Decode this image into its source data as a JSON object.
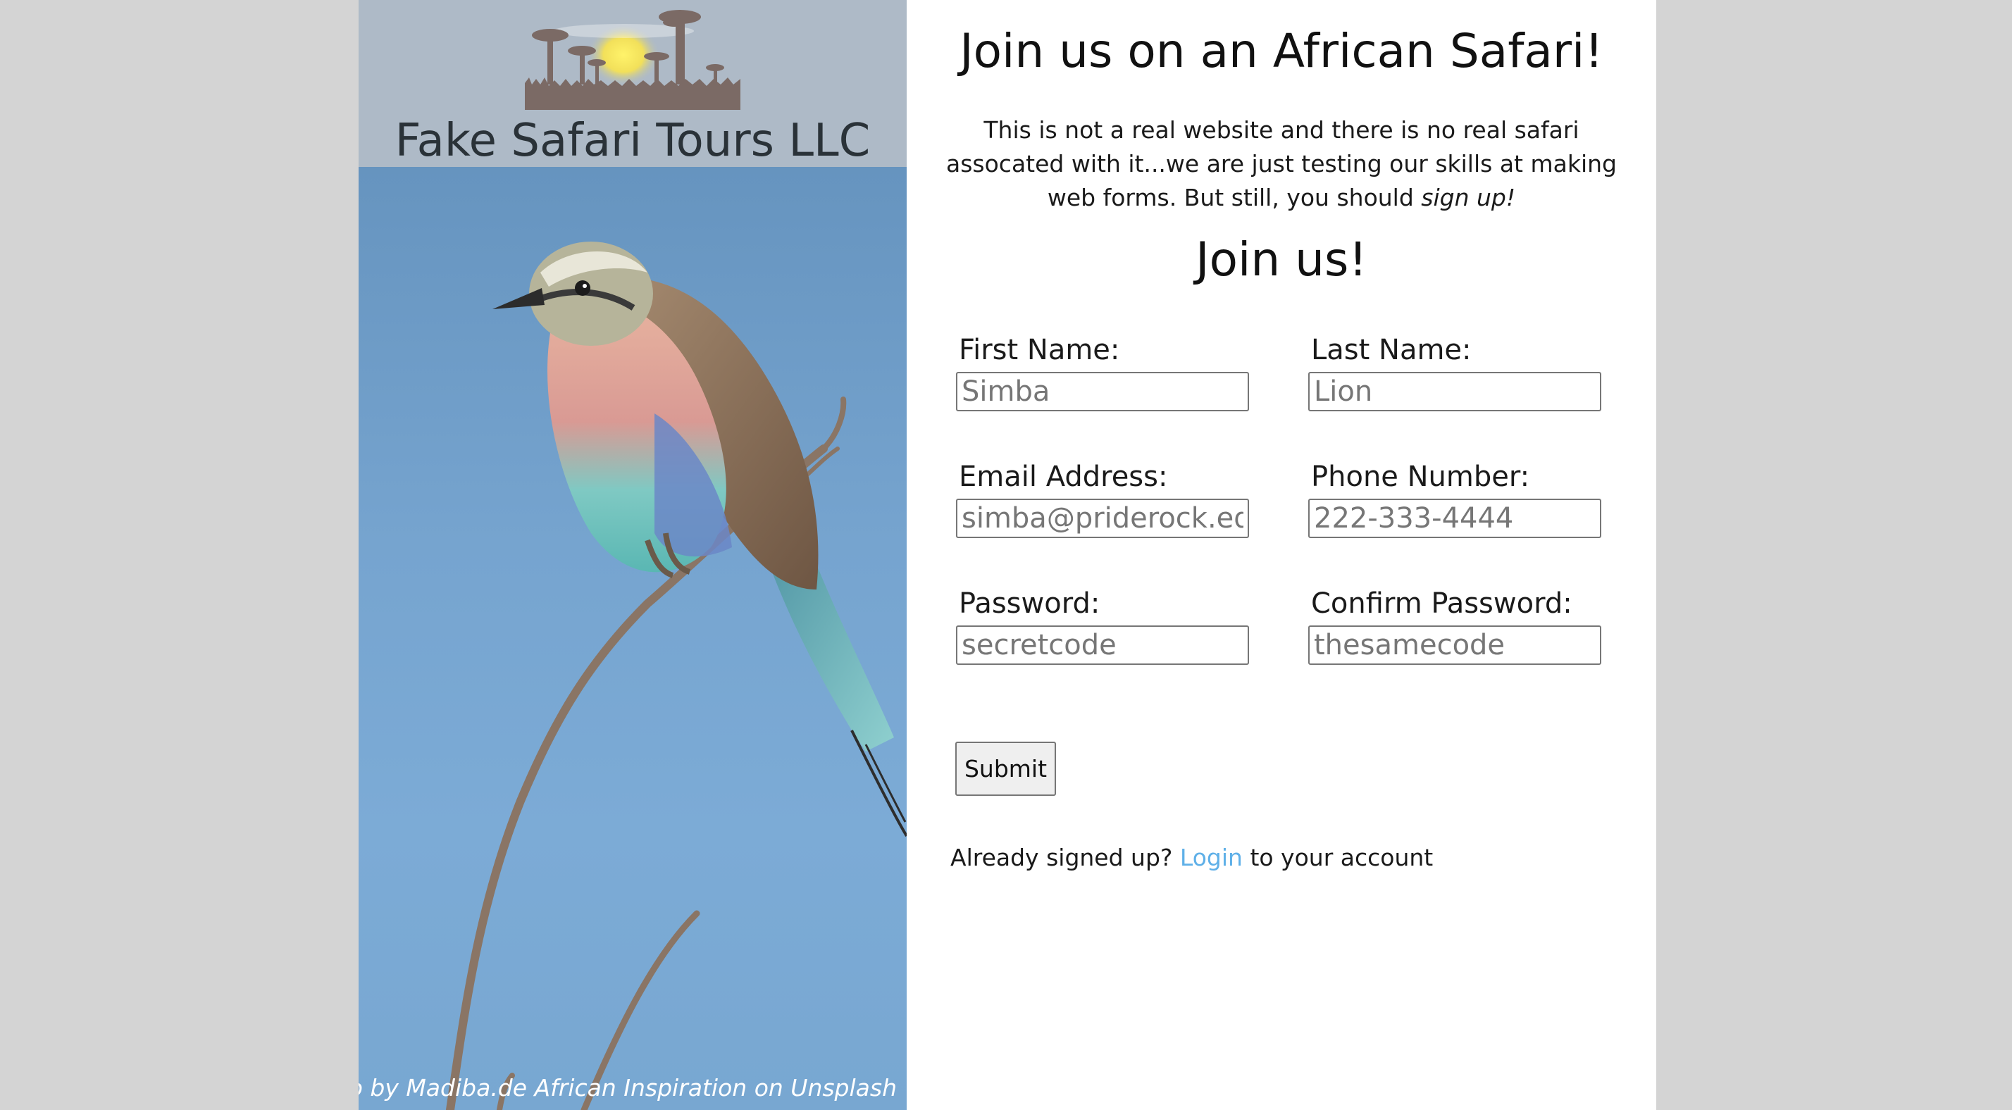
{
  "brand": {
    "name": "Fake Safari Tours LLC",
    "logo": "baobab-sunset-logo"
  },
  "photo": {
    "subject": "lilac-breasted-roller-photo",
    "credit": "Photo by Madiba.de African Inspiration on Unsplash"
  },
  "main": {
    "headline": "Join us on an African Safari!",
    "intro_text": "This is not a real website and there is no real safari assocated with it...we are just testing our skills at making web forms. But still, you should ",
    "intro_emphasis": "sign up!"
  },
  "form": {
    "title": "Join us!",
    "first_name": {
      "label": "First Name:",
      "placeholder": "Simba"
    },
    "last_name": {
      "label": "Last Name:",
      "placeholder": "Lion"
    },
    "email": {
      "label": "Email Address:",
      "placeholder": "simba@priderock.edu"
    },
    "phone": {
      "label": "Phone Number:",
      "placeholder": "222-333-4444"
    },
    "password": {
      "label": "Password:",
      "placeholder": "secretcode"
    },
    "confirm_password": {
      "label": "Confirm Password:",
      "placeholder": "thesamecode"
    },
    "submit_label": "Submit"
  },
  "login_prompt": {
    "before": "Already signed up? ",
    "link": "Login",
    "after": " to your account"
  },
  "colors": {
    "page_bg": "#d4d4d4",
    "brand_bg": "#aebac7",
    "link": "#5fb0e8",
    "sky": "#76a4cf"
  }
}
